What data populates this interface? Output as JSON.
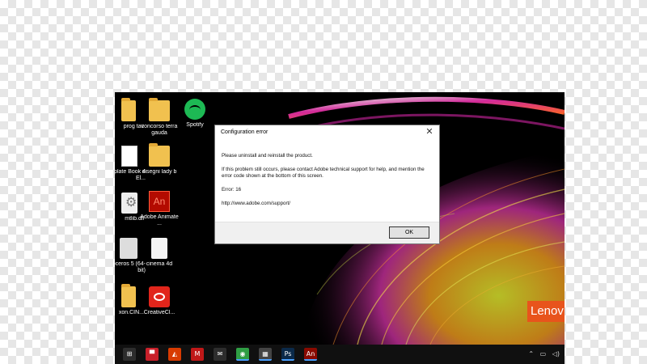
{
  "desktop": {
    "icons": [
      {
        "label": "prog tav"
      },
      {
        "label": "concorso terra gauda"
      },
      {
        "label": "Spotify"
      },
      {
        "label": "template Book 4 El..."
      },
      {
        "label": "disegni lady b"
      },
      {
        "label": "mtlib.dll"
      },
      {
        "label": "Adobe Animate ..."
      },
      {
        "label": "noceros 5 (64-bit)"
      },
      {
        "label": "cinema 4d"
      },
      {
        "label": "xon.CIN..."
      },
      {
        "label": "CreativeCl..."
      }
    ],
    "adobe_an_glyph": "An",
    "brand_logo_text": "Lenov"
  },
  "dialog": {
    "title": "Configuration error",
    "close_glyph": "✕",
    "line1": "Please uninstall and reinstall the product.",
    "line2": "If this problem still occurs, please contact Adobe technical support for help, and mention the error code shown at the bottom of this screen.",
    "error_line": "Error: 16",
    "support_url": "http://www.adobe.com/support/",
    "ok_label": "OK"
  },
  "taskbar": {
    "items": [
      {
        "name": "windows-store-icon",
        "glyph": "⊞",
        "color": "#2d2d2d"
      },
      {
        "name": "mail-app-icon",
        "glyph": "▀",
        "color": "#c8202a"
      },
      {
        "name": "acrobat-icon",
        "glyph": "◭",
        "color": "#d83b01"
      },
      {
        "name": "mcafee-icon",
        "glyph": "M",
        "color": "#c01818"
      },
      {
        "name": "envelope-icon",
        "glyph": "✉",
        "color": "#2d2d2d"
      },
      {
        "name": "chrome-icon",
        "glyph": "◉",
        "color": "#2f9e44"
      },
      {
        "name": "calculator-icon",
        "glyph": "▦",
        "color": "#444444"
      },
      {
        "name": "photoshop-icon",
        "glyph": "Ps",
        "color": "#0b2a4a"
      },
      {
        "name": "animate-icon",
        "glyph": "An",
        "color": "#8a0a00"
      }
    ],
    "tray": {
      "chevron": "⌃",
      "network": "▭",
      "volume": "◁)"
    }
  }
}
